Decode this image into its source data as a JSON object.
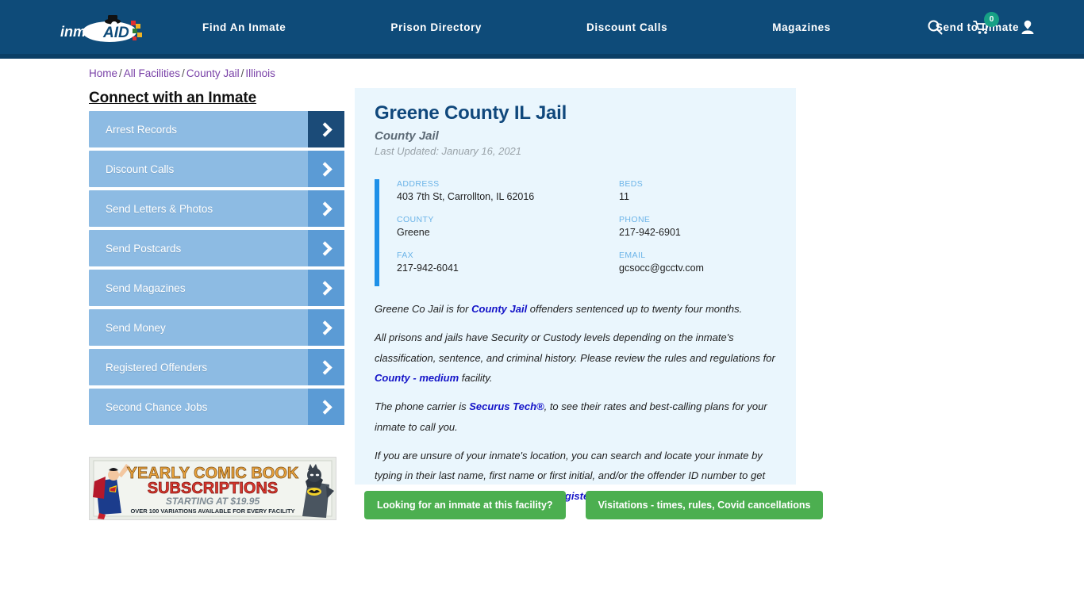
{
  "header": {
    "logo_alt": "InmateAid",
    "nav": [
      {
        "label": "Find An Inmate",
        "has_caret": false
      },
      {
        "label": "Prison Directory",
        "has_caret": false
      },
      {
        "label": "Discount Calls",
        "has_caret": false
      },
      {
        "label": "Magazines",
        "has_caret": false
      },
      {
        "label": "Send to Inmate",
        "has_caret": true
      }
    ],
    "icons": {
      "search": "search-icon",
      "cart": "shopping-cart-icon",
      "cart_count": "0",
      "account": "user-account-icon"
    },
    "bar_color": "#0e4b79",
    "badge_color": "#16a085"
  },
  "breadcrumb": {
    "items": [
      "Home",
      "All Facilities",
      "County Jail",
      "Illinois"
    ],
    "separator": "/",
    "link_color": "#7a42a8"
  },
  "sidebar": {
    "title": "Connect with an Inmate",
    "items": [
      {
        "label": "Arrest Records",
        "hovered": true
      },
      {
        "label": "Discount Calls",
        "hovered": false
      },
      {
        "label": "Send Letters & Photos",
        "hovered": false
      },
      {
        "label": "Send Postcards",
        "hovered": false
      },
      {
        "label": "Send Magazines",
        "hovered": false
      },
      {
        "label": "Send Money",
        "hovered": false
      },
      {
        "label": "Registered Offenders",
        "hovered": false
      },
      {
        "label": "Second Chance Jobs",
        "hovered": false
      }
    ],
    "item_color": "#8dbbe3",
    "arrow_color": "#5b9bd5",
    "arrow_hover_color": "#1b4b78"
  },
  "ad": {
    "line1": "YEARLY COMIC BOOK",
    "line2": "SUBSCRIPTIONS",
    "line3": "STARTING AT $19.95",
    "line4": "OVER 100 VARIATIONS AVAILABLE FOR EVERY FACILITY"
  },
  "facility": {
    "title": "Greene County IL Jail",
    "subtitle": "County Jail",
    "last_updated": "Last Updated: January 16, 2021",
    "accent_color": "#1e90e8",
    "card_bg": "#eaf6fd",
    "details": [
      {
        "label": "ADDRESS",
        "value": "403 7th St, Carrollton, IL 62016"
      },
      {
        "label": "BEDS",
        "value": "11"
      },
      {
        "label": "COUNTY",
        "value": "Greene"
      },
      {
        "label": "PHONE",
        "value": "217-942-6901"
      },
      {
        "label": "FAX",
        "value": "217-942-6041"
      },
      {
        "label": "EMAIL",
        "value": "gcsocc@gcctv.com"
      }
    ],
    "paragraphs": {
      "p1_a": "Greene Co Jail is for ",
      "p1_link": "County Jail",
      "p1_b": " offenders sentenced up to twenty four months.",
      "p2_a": "All prisons and jails have Security or Custody levels depending on the inmate's classification, sentence, and criminal history. Please review the rules and regulations for ",
      "p2_link": "County - medium",
      "p2_b": " facility.",
      "p3_a": "The phone carrier is ",
      "p3_link": "Securus Tech®",
      "p3_b": ", to see their rates and best-calling plans for your inmate to call you.",
      "p4_a": "If you are unsure of your inmate's location, you can search and locate your inmate by typing in their last name, first name or first initial, and/or the offender ID number to get their accurate information immediately ",
      "p4_link": "Registered Offenders",
      "p4_b": ""
    }
  },
  "actions": {
    "find_inmate_label": "Looking for an inmate at this facility?",
    "visitations_label": "Visitations - times, rules, Covid cancellations",
    "button_color": "#4caf50"
  }
}
